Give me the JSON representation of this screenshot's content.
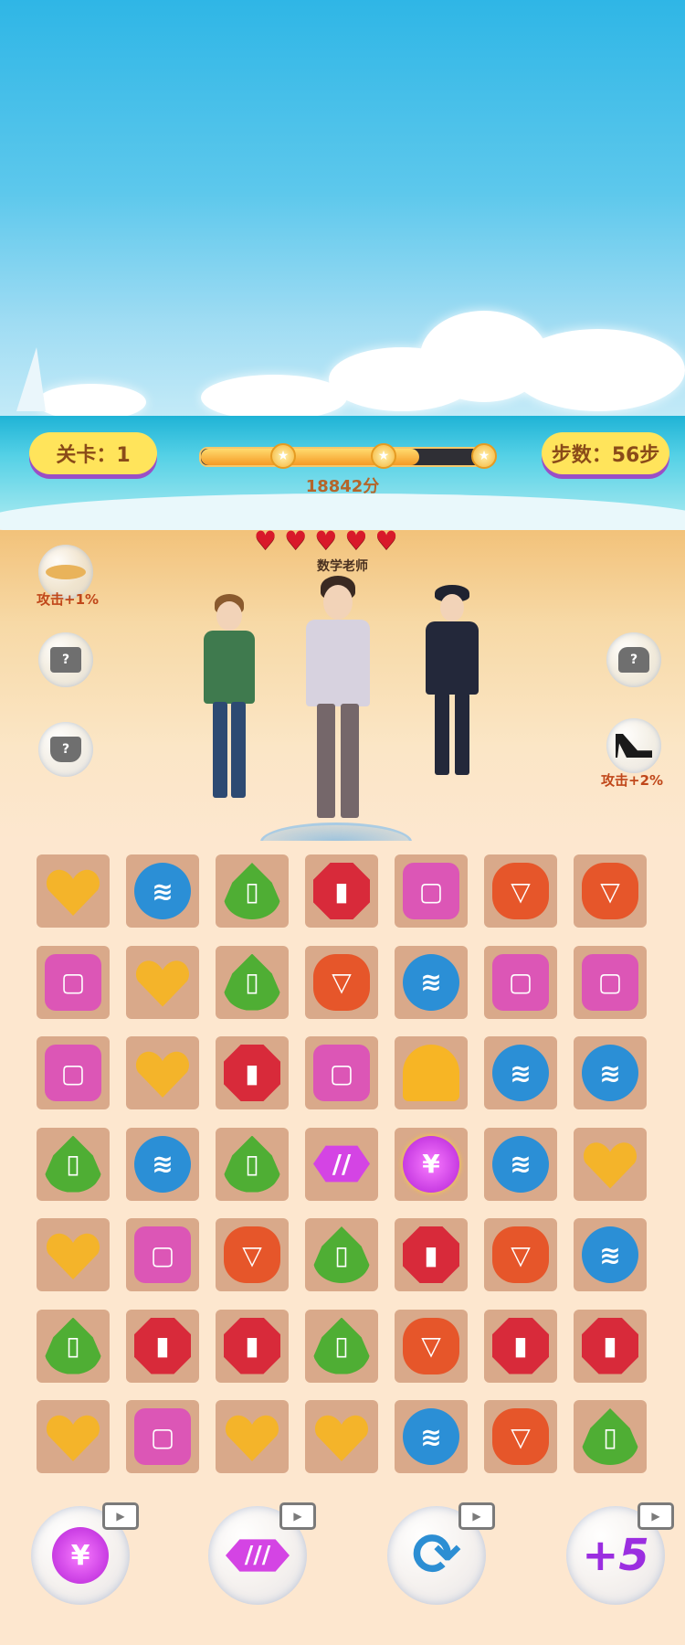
{
  "hud": {
    "level_label": "关卡：1",
    "steps_label": "步数：56步",
    "score_text": "18842分",
    "progress_fraction": 0.75,
    "milestone_star_icon": "star-icon"
  },
  "character": {
    "name": "数学老师",
    "hearts": 5
  },
  "equipment": {
    "left": [
      {
        "icon": "hat-icon",
        "bonus": "攻击+1%",
        "locked": false
      },
      {
        "icon": "shirt-icon",
        "bonus": "",
        "locked": true,
        "mark": "?"
      },
      {
        "icon": "skirt-icon",
        "bonus": "",
        "locked": true,
        "mark": "?"
      }
    ],
    "right": [
      {
        "icon": "bag-icon",
        "bonus": "",
        "locked": true,
        "mark": "?"
      },
      {
        "icon": "high-heels-icon",
        "bonus": "攻击+2%",
        "locked": false
      }
    ]
  },
  "board": {
    "rows": 7,
    "cols": 7,
    "cells": [
      [
        "heels",
        "bag",
        "lotion",
        "lipstick",
        "perfume",
        "skirt",
        "skirt"
      ],
      [
        "perfume",
        "heels",
        "lotion",
        "skirt",
        "bag",
        "perfume",
        "perfume"
      ],
      [
        "perfume",
        "heels",
        "lipstick",
        "perfume",
        "shell",
        "bag",
        "bag"
      ],
      [
        "lotion",
        "bag",
        "lotion",
        "rocket",
        "bomb",
        "bag",
        "heels"
      ],
      [
        "heels",
        "perfume",
        "skirt",
        "lotion",
        "lipstick",
        "skirt",
        "bag"
      ],
      [
        "lotion",
        "lipstick",
        "lipstick",
        "lotion",
        "skirt",
        "lipstick",
        "lipstick"
      ],
      [
        "heels",
        "perfume",
        "heels",
        "heels",
        "bag",
        "skirt",
        "lotion"
      ]
    ],
    "gem_colors": {
      "heels": "#f4b42a",
      "bag": "#2b8fd6",
      "lotion": "#4fae34",
      "lipstick": "#d82a3a",
      "perfume": "#dc56b6",
      "skirt": "#e6562a",
      "shell": "#f7b525",
      "bomb": "#b321d6",
      "rocket": "#d444e4"
    },
    "bomb_symbol": "¥"
  },
  "powerups": [
    {
      "name": "bomb-powerup",
      "icon": "bomb-icon",
      "symbol": "¥",
      "video_icon": "video-play-icon"
    },
    {
      "name": "rocket-powerup",
      "icon": "rocket-icon",
      "symbol": "",
      "video_icon": "video-play-icon"
    },
    {
      "name": "shuffle-powerup",
      "icon": "refresh-icon",
      "symbol": "",
      "video_icon": "video-play-icon"
    },
    {
      "name": "extra-steps-powerup",
      "icon": "plus-five-icon",
      "symbol": "+5",
      "video_icon": "video-play-icon"
    }
  ]
}
